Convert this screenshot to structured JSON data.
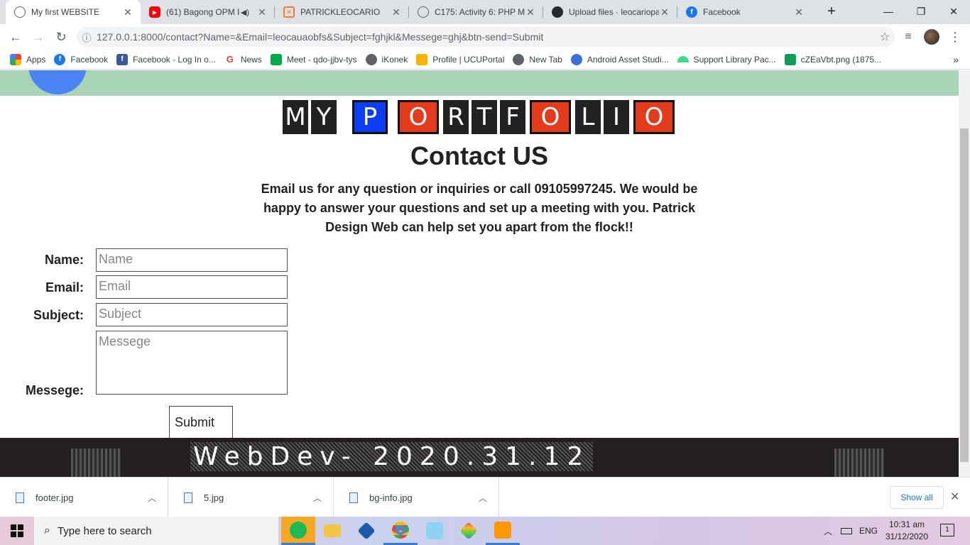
{
  "tabs": [
    {
      "title": "My first WEBSITE",
      "icon": "globe-icon",
      "active": true
    },
    {
      "title": "(61) Bagong OPM I",
      "icon": "youtube-icon",
      "audio": true
    },
    {
      "title": "PATRICKLEOCARIO",
      "icon": "xampp-icon"
    },
    {
      "title": "C175: Activity 6: PHP M",
      "icon": "globe-icon"
    },
    {
      "title": "Upload files · leocariopa",
      "icon": "github-icon"
    },
    {
      "title": "Facebook",
      "icon": "facebook-icon"
    }
  ],
  "new_tab_label": "+",
  "window": {
    "minimize": "—",
    "maximize": "❐",
    "close": "✕"
  },
  "address": {
    "url": "127.0.0.1:8000/contact?Name=&Email=leocauaobfs&Subject=fghjkl&Messege=ghj&btn-send=Submit"
  },
  "bookmarks": [
    {
      "label": "Apps",
      "icon": "apps-grid-icon",
      "color": "#4285f4"
    },
    {
      "label": "Facebook",
      "icon": "facebook-icon",
      "color": "#1877f2"
    },
    {
      "label": "Facebook - Log In o...",
      "icon": "facebook-icon",
      "color": "#3b5998"
    },
    {
      "label": "News",
      "icon": "google-icon",
      "color": "#ea4335"
    },
    {
      "label": "Meet - qdo-jjbv-tys",
      "icon": "meet-icon",
      "color": "#00ac47"
    },
    {
      "label": "iKonek",
      "icon": "globe-icon",
      "color": "#5f6368"
    },
    {
      "label": "Profile | UCUPortal",
      "icon": "portal-icon",
      "color": "#f4b400"
    },
    {
      "label": "New Tab",
      "icon": "globe-icon",
      "color": "#5f6368"
    },
    {
      "label": "Android Asset Studi...",
      "icon": "android-studio-icon",
      "color": "#3b6fd6"
    },
    {
      "label": "Support Library Pac...",
      "icon": "android-icon",
      "color": "#3ddc84"
    },
    {
      "label": "cZEaVbt.png (1875...",
      "icon": "image-icon",
      "color": "#0f9d58"
    }
  ],
  "page": {
    "logo_letters": [
      "M",
      "Y",
      "",
      "P",
      "",
      "O",
      "R",
      "T",
      "F",
      "O",
      "L",
      "I",
      "O"
    ],
    "title": "Contact US",
    "intro": "Email us for any question or inquiries or call 09105997245. We would be happy to answer your questions and set up a meeting with you. Patrick Design Web can help set you apart from the flock!!",
    "form": {
      "name_label": "Name:",
      "name_placeholder": "Name",
      "email_label": "Email:",
      "email_placeholder": "Email",
      "subject_label": "Subject:",
      "subject_placeholder": "Subject",
      "message_label": "Messege:",
      "message_placeholder": "Messege",
      "submit": "Submit"
    },
    "footer_text": "WebDev- 2020.31.12"
  },
  "downloads": [
    {
      "name": "footer.jpg"
    },
    {
      "name": "5.jpg"
    },
    {
      "name": "bg-info.jpg"
    }
  ],
  "downloads_show_all": "Show all",
  "taskbar": {
    "search_placeholder": "Type here to search",
    "lang": "ENG",
    "time": "10:31 am",
    "date": "31/12/2020",
    "notifications": "1"
  }
}
